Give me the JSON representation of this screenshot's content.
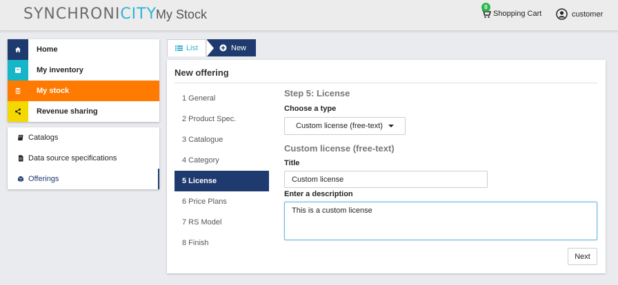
{
  "header": {
    "logo_part1": "SYNCHRONI",
    "logo_part2": "CITY",
    "title": "My Stock",
    "cart_label": "Shopping Cart",
    "cart_count": "0",
    "user_label": "customer"
  },
  "nav": {
    "items": [
      {
        "label": "Home",
        "icon": "home-icon",
        "color": "#1f3a6e"
      },
      {
        "label": "My inventory",
        "icon": "inventory-icon",
        "color": "#17b5c8"
      },
      {
        "label": "My stock",
        "icon": "database-icon",
        "color": "#ff7a00"
      },
      {
        "label": "Revenue sharing",
        "icon": "share-icon",
        "color": "#f5d800"
      }
    ],
    "sub_items": [
      {
        "label": "Catalogs",
        "icon": "book-icon"
      },
      {
        "label": "Data source specifications",
        "icon": "document-icon"
      },
      {
        "label": "Offerings",
        "icon": "cube-icon"
      }
    ]
  },
  "tabs": {
    "list_label": "List",
    "new_label": "New"
  },
  "panel": {
    "title": "New offering",
    "steps": [
      "1 General",
      "2 Product Spec.",
      "3 Catalogue",
      "4 Category",
      "5 License",
      "6 Price Plans",
      "7 RS Model",
      "8 Finish"
    ],
    "active_step": 4,
    "step_heading": "Step 5: License",
    "type_label": "Choose a type",
    "type_value": "Custom license (free-text)",
    "sub_heading": "Custom license (free-text)",
    "title_label": "Title",
    "title_value": "Custom license",
    "description_label": "Enter a description",
    "description_value": "This is a custom license",
    "next_label": "Next"
  }
}
